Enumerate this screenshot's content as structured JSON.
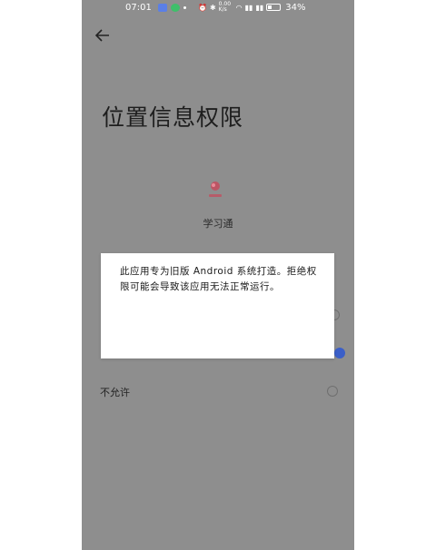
{
  "status_bar": {
    "time": "07:01",
    "battery": "34%",
    "network": "0.00 K/s"
  },
  "header": {
    "back_icon": "arrow-left-icon"
  },
  "page": {
    "title": "位置信息权限"
  },
  "app": {
    "name": "学习通"
  },
  "options": [
    {
      "label": "",
      "selected": false
    },
    {
      "label": "",
      "selected": true
    },
    {
      "label": "不允许",
      "selected": false
    }
  ],
  "dialog": {
    "message": "此应用专为旧版 Android 系统打造。拒绝权限可能会导致该应用无法正常运行。"
  },
  "colors": {
    "overlay_bg": "#8e8e8e",
    "accent": "#3b5fc8"
  }
}
